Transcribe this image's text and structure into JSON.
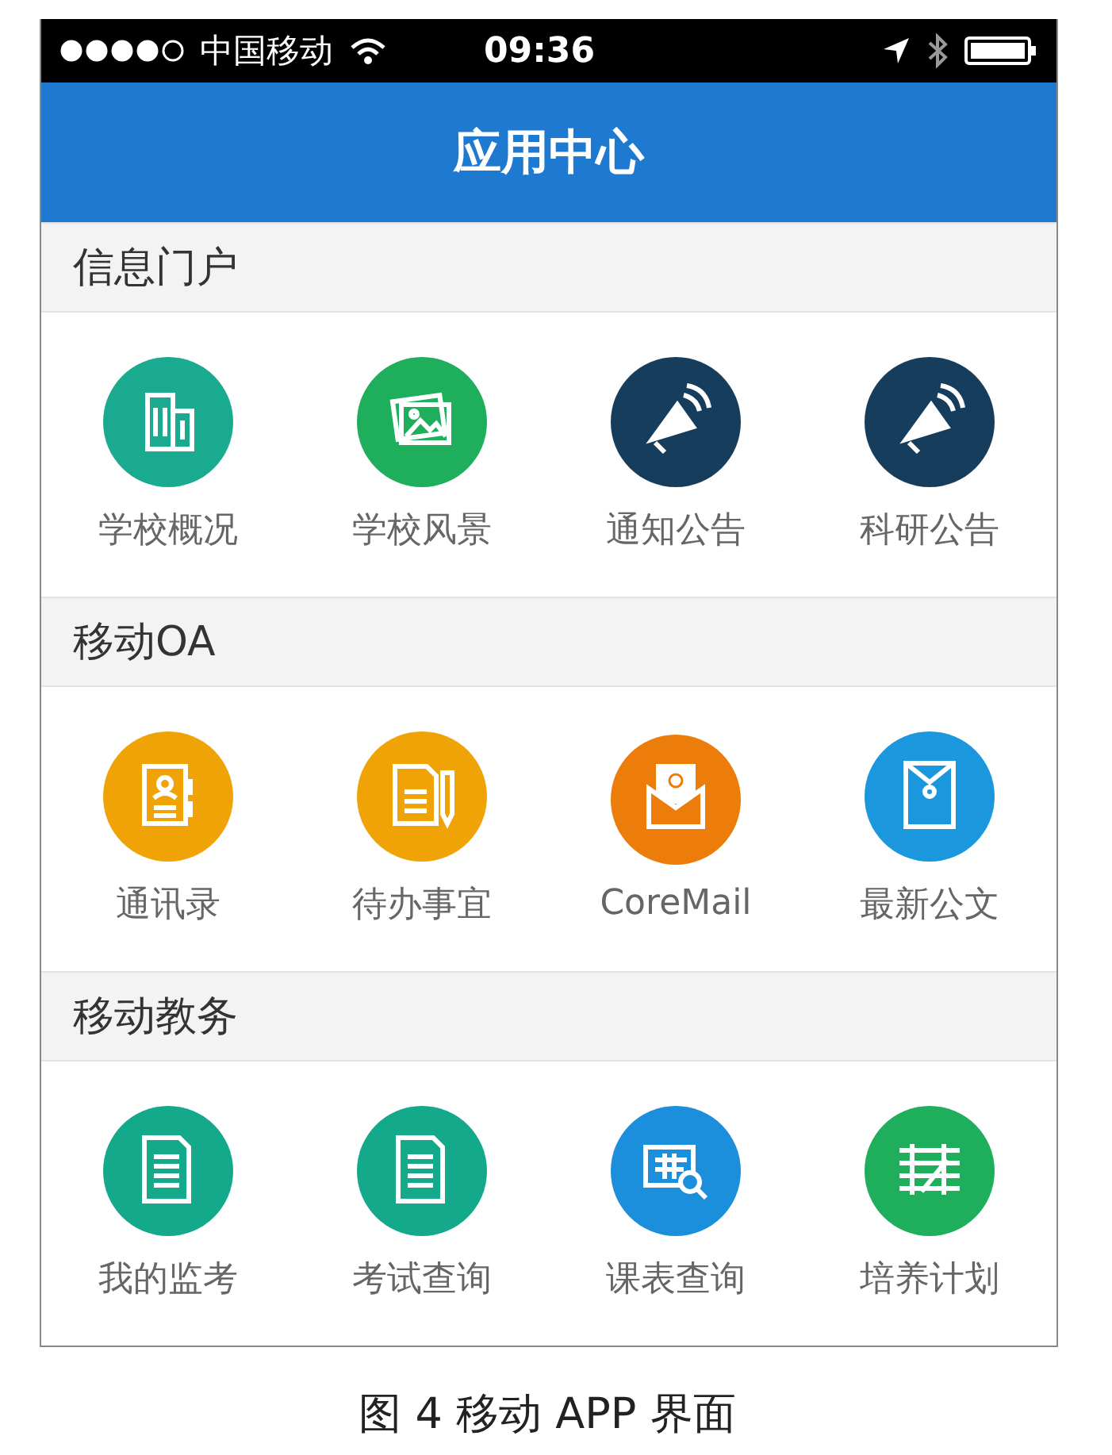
{
  "status_bar": {
    "carrier": "中国移动",
    "time": "09:36"
  },
  "header": {
    "title": "应用中心"
  },
  "sections": [
    {
      "title": "信息门户",
      "apps": [
        {
          "label": "学校概况",
          "kind": "building",
          "color": "#1aaa8f"
        },
        {
          "label": "学校风景",
          "kind": "photos",
          "color": "#1fae5c"
        },
        {
          "label": "通知公告",
          "kind": "megaphone",
          "color": "#163e5c"
        },
        {
          "label": "科研公告",
          "kind": "megaphone",
          "color": "#163e5c"
        }
      ]
    },
    {
      "title": "移动OA",
      "apps": [
        {
          "label": "通讯录",
          "kind": "contacts",
          "color": "#f0a306"
        },
        {
          "label": "待办事宜",
          "kind": "docpen",
          "color": "#f0a306"
        },
        {
          "label": "CoreMail",
          "kind": "mail",
          "color": "#ec7d0a"
        },
        {
          "label": "最新公文",
          "kind": "folder",
          "color": "#1b97dd"
        }
      ]
    },
    {
      "title": "移动教务",
      "apps": [
        {
          "label": "我的监考",
          "kind": "doc",
          "color": "#14a98a"
        },
        {
          "label": "考试查询",
          "kind": "doc",
          "color": "#14a98a"
        },
        {
          "label": "课表查询",
          "kind": "tablesearch",
          "color": "#1b8fdc"
        },
        {
          "label": "培养计划",
          "kind": "grid",
          "color": "#1fae5c"
        }
      ]
    }
  ],
  "caption": "图 4  移动 APP 界面"
}
